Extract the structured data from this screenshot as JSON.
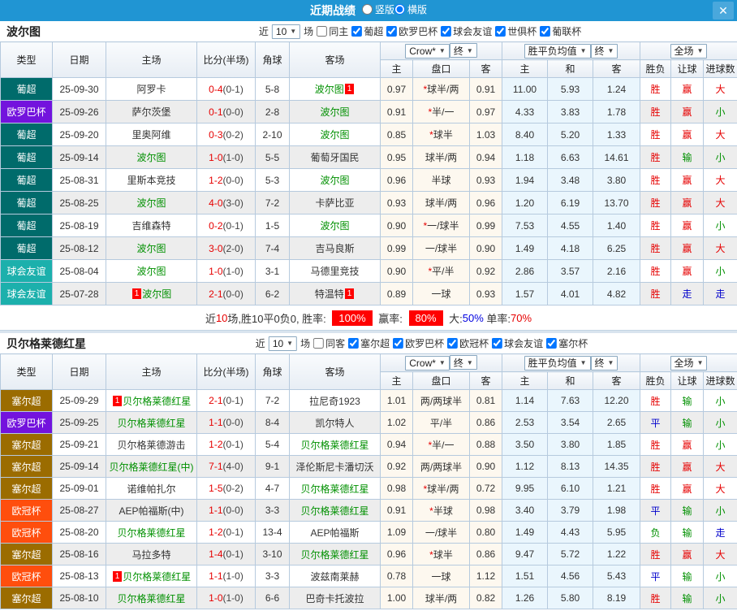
{
  "titlebar": {
    "title": "近期战绩",
    "radios": [
      {
        "label": "竖版",
        "selected": false
      },
      {
        "label": "横版",
        "selected": true
      }
    ],
    "close_label": "X"
  },
  "table_header": {
    "cols": [
      "类型",
      "日期",
      "主场",
      "比分(半场)",
      "角球",
      "客场"
    ],
    "odds_group": {
      "select1": "Crow*",
      "select2": "终",
      "sub": [
        "主",
        "盘口",
        "客"
      ]
    },
    "avg_group": {
      "select1": "胜平负均值",
      "select2": "终",
      "sub": [
        "主",
        "和",
        "客"
      ]
    },
    "result_group": {
      "select": "全场",
      "sub": [
        "胜负",
        "让球",
        "进球数"
      ]
    }
  },
  "sections": [
    {
      "team": "波尔图",
      "filter": {
        "near_label": "近",
        "count": "10",
        "games_label": "场",
        "same_label": "同主",
        "same_checked": false,
        "leagues": [
          {
            "label": "葡超",
            "checked": true
          },
          {
            "label": "欧罗巴杯",
            "checked": true
          },
          {
            "label": "球会友谊",
            "checked": true
          },
          {
            "label": "世俱杯",
            "checked": true
          },
          {
            "label": "葡联杯",
            "checked": true
          }
        ]
      },
      "rows": [
        {
          "type": "葡超",
          "tc": "#006b6b",
          "date": "25-09-30",
          "home": "阿罗卡",
          "homeGreen": false,
          "homeBadge": "",
          "ft": "0-4",
          "ht": "(0-1)",
          "corner": "5-8",
          "away": "波尔图",
          "awayGreen": true,
          "awayBadge": "1",
          "o1": "0.97",
          "star": true,
          "hcap": "球半/两",
          "o2": "0.91",
          "a1": "11.00",
          "a2": "5.93",
          "a3": "1.24",
          "res": [
            [
              "胜",
              "r"
            ],
            [
              "赢",
              "r"
            ],
            [
              "大",
              "r"
            ]
          ]
        },
        {
          "type": "欧罗巴杯",
          "tc": "#7313dd",
          "date": "25-09-26",
          "home": "萨尔茨堡",
          "homeGreen": false,
          "homeBadge": "",
          "ft": "0-1",
          "ht": "(0-0)",
          "corner": "2-8",
          "away": "波尔图",
          "awayGreen": true,
          "awayBadge": "",
          "o1": "0.91",
          "star": true,
          "hcap": "半/一",
          "o2": "0.97",
          "a1": "4.33",
          "a2": "3.83",
          "a3": "1.78",
          "res": [
            [
              "胜",
              "r"
            ],
            [
              "赢",
              "r"
            ],
            [
              "小",
              "g"
            ]
          ]
        },
        {
          "type": "葡超",
          "tc": "#006b6b",
          "date": "25-09-20",
          "home": "里奥阿维",
          "homeGreen": false,
          "homeBadge": "",
          "ft": "0-3",
          "ht": "(0-2)",
          "corner": "2-10",
          "away": "波尔图",
          "awayGreen": true,
          "awayBadge": "",
          "o1": "0.85",
          "star": true,
          "hcap": "球半",
          "o2": "1.03",
          "a1": "8.40",
          "a2": "5.20",
          "a3": "1.33",
          "res": [
            [
              "胜",
              "r"
            ],
            [
              "赢",
              "r"
            ],
            [
              "大",
              "r"
            ]
          ]
        },
        {
          "type": "葡超",
          "tc": "#006b6b",
          "date": "25-09-14",
          "home": "波尔图",
          "homeGreen": true,
          "homeBadge": "",
          "ft": "1-0",
          "ht": "(1-0)",
          "corner": "5-5",
          "away": "葡萄牙国民",
          "awayGreen": false,
          "awayBadge": "",
          "o1": "0.95",
          "star": false,
          "hcap": "球半/两",
          "o2": "0.94",
          "a1": "1.18",
          "a2": "6.63",
          "a3": "14.61",
          "res": [
            [
              "胜",
              "r"
            ],
            [
              "输",
              "g"
            ],
            [
              "小",
              "g"
            ]
          ]
        },
        {
          "type": "葡超",
          "tc": "#006b6b",
          "date": "25-08-31",
          "home": "里斯本竞技",
          "homeGreen": false,
          "homeBadge": "",
          "ft": "1-2",
          "ht": "(0-0)",
          "corner": "5-3",
          "away": "波尔图",
          "awayGreen": true,
          "awayBadge": "",
          "o1": "0.96",
          "star": false,
          "hcap": "半球",
          "o2": "0.93",
          "a1": "1.94",
          "a2": "3.48",
          "a3": "3.80",
          "res": [
            [
              "胜",
              "r"
            ],
            [
              "赢",
              "r"
            ],
            [
              "大",
              "r"
            ]
          ]
        },
        {
          "type": "葡超",
          "tc": "#006b6b",
          "date": "25-08-25",
          "home": "波尔图",
          "homeGreen": true,
          "homeBadge": "",
          "ft": "4-0",
          "ht": "(3-0)",
          "corner": "7-2",
          "away": "卡萨比亚",
          "awayGreen": false,
          "awayBadge": "",
          "o1": "0.93",
          "star": false,
          "hcap": "球半/两",
          "o2": "0.96",
          "a1": "1.20",
          "a2": "6.19",
          "a3": "13.70",
          "res": [
            [
              "胜",
              "r"
            ],
            [
              "赢",
              "r"
            ],
            [
              "大",
              "r"
            ]
          ]
        },
        {
          "type": "葡超",
          "tc": "#006b6b",
          "date": "25-08-19",
          "home": "吉维森特",
          "homeGreen": false,
          "homeBadge": "",
          "ft": "0-2",
          "ht": "(0-1)",
          "corner": "1-5",
          "away": "波尔图",
          "awayGreen": true,
          "awayBadge": "",
          "o1": "0.90",
          "star": true,
          "hcap": "一/球半",
          "o2": "0.99",
          "a1": "7.53",
          "a2": "4.55",
          "a3": "1.40",
          "res": [
            [
              "胜",
              "r"
            ],
            [
              "赢",
              "r"
            ],
            [
              "小",
              "g"
            ]
          ]
        },
        {
          "type": "葡超",
          "tc": "#006b6b",
          "date": "25-08-12",
          "home": "波尔图",
          "homeGreen": true,
          "homeBadge": "",
          "ft": "3-0",
          "ht": "(2-0)",
          "corner": "7-4",
          "away": "吉马良斯",
          "awayGreen": false,
          "awayBadge": "",
          "o1": "0.99",
          "star": false,
          "hcap": "一/球半",
          "o2": "0.90",
          "a1": "1.49",
          "a2": "4.18",
          "a3": "6.25",
          "res": [
            [
              "胜",
              "r"
            ],
            [
              "赢",
              "r"
            ],
            [
              "大",
              "r"
            ]
          ]
        },
        {
          "type": "球会友谊",
          "tc": "#1cb0ac",
          "date": "25-08-04",
          "home": "波尔图",
          "homeGreen": true,
          "homeBadge": "",
          "ft": "1-0",
          "ht": "(1-0)",
          "corner": "3-1",
          "away": "马德里竞技",
          "awayGreen": false,
          "awayBadge": "",
          "o1": "0.90",
          "star": true,
          "hcap": "平/半",
          "o2": "0.92",
          "a1": "2.86",
          "a2": "3.57",
          "a3": "2.16",
          "res": [
            [
              "胜",
              "r"
            ],
            [
              "赢",
              "r"
            ],
            [
              "小",
              "g"
            ]
          ]
        },
        {
          "type": "球会友谊",
          "tc": "#1cb0ac",
          "date": "25-07-28",
          "home": "波尔图",
          "homeGreen": true,
          "homeBadge": "1",
          "ft": "2-1",
          "ht": "(0-0)",
          "corner": "6-2",
          "away": "特温特",
          "awayGreen": false,
          "awayBadge": "1",
          "o1": "0.89",
          "star": false,
          "hcap": "一球",
          "o2": "0.93",
          "a1": "1.57",
          "a2": "4.01",
          "a3": "4.82",
          "res": [
            [
              "胜",
              "r"
            ],
            [
              "走",
              "b"
            ],
            [
              "走",
              "b"
            ]
          ]
        }
      ],
      "summary": [
        [
          "近",
          "k"
        ],
        [
          "10",
          "r"
        ],
        [
          "场,胜10平0负0, 胜率: ",
          "k"
        ],
        [
          "100%",
          "hl"
        ],
        [
          " 赢率: ",
          "k"
        ],
        [
          "80%",
          "hl"
        ],
        [
          " 大:",
          "k"
        ],
        [
          "50%",
          "b"
        ],
        [
          " 单率:",
          "k"
        ],
        [
          "70%",
          "r"
        ]
      ]
    },
    {
      "team": "贝尔格莱德红星",
      "filter": {
        "near_label": "近",
        "count": "10",
        "games_label": "场",
        "same_label": "同客",
        "same_checked": false,
        "leagues": [
          {
            "label": "塞尔超",
            "checked": true
          },
          {
            "label": "欧罗巴杯",
            "checked": true
          },
          {
            "label": "欧冠杯",
            "checked": true
          },
          {
            "label": "球会友谊",
            "checked": true
          },
          {
            "label": "塞尔杯",
            "checked": true
          }
        ]
      },
      "rows": [
        {
          "type": "塞尔超",
          "tc": "#9b6c00",
          "date": "25-09-29",
          "home": "贝尔格莱德红星",
          "homeGreen": true,
          "homeBadge": "1",
          "ft": "2-1",
          "ht": "(0-1)",
          "corner": "7-2",
          "away": "拉尼奇1923",
          "awayGreen": false,
          "awayBadge": "",
          "o1": "1.01",
          "star": false,
          "hcap": "两/两球半",
          "o2": "0.81",
          "a1": "1.14",
          "a2": "7.63",
          "a3": "12.20",
          "res": [
            [
              "胜",
              "r"
            ],
            [
              "输",
              "g"
            ],
            [
              "小",
              "g"
            ]
          ]
        },
        {
          "type": "欧罗巴杯",
          "tc": "#7313dd",
          "date": "25-09-25",
          "home": "贝尔格莱德红星",
          "homeGreen": true,
          "homeBadge": "",
          "ft": "1-1",
          "ht": "(0-0)",
          "corner": "8-4",
          "away": "凯尔特人",
          "awayGreen": false,
          "awayBadge": "",
          "o1": "1.02",
          "star": false,
          "hcap": "平/半",
          "o2": "0.86",
          "a1": "2.53",
          "a2": "3.54",
          "a3": "2.65",
          "res": [
            [
              "平",
              "b"
            ],
            [
              "输",
              "g"
            ],
            [
              "小",
              "g"
            ]
          ]
        },
        {
          "type": "塞尔超",
          "tc": "#9b6c00",
          "date": "25-09-21",
          "home": "贝尔格莱德游击",
          "homeGreen": false,
          "homeBadge": "",
          "ft": "1-2",
          "ht": "(0-1)",
          "corner": "5-4",
          "away": "贝尔格莱德红星",
          "awayGreen": true,
          "awayBadge": "",
          "o1": "0.94",
          "star": true,
          "hcap": "半/一",
          "o2": "0.88",
          "a1": "3.50",
          "a2": "3.80",
          "a3": "1.85",
          "res": [
            [
              "胜",
              "r"
            ],
            [
              "赢",
              "r"
            ],
            [
              "小",
              "g"
            ]
          ]
        },
        {
          "type": "塞尔超",
          "tc": "#9b6c00",
          "date": "25-09-14",
          "home": "贝尔格莱德红星(中)",
          "homeGreen": true,
          "homeBadge": "",
          "ft": "7-1",
          "ht": "(4-0)",
          "corner": "9-1",
          "away": "泽伦斯尼卡潘切沃",
          "awayGreen": false,
          "awayBadge": "",
          "o1": "0.92",
          "star": false,
          "hcap": "两/两球半",
          "o2": "0.90",
          "a1": "1.12",
          "a2": "8.13",
          "a3": "14.35",
          "res": [
            [
              "胜",
              "r"
            ],
            [
              "赢",
              "r"
            ],
            [
              "大",
              "r"
            ]
          ]
        },
        {
          "type": "塞尔超",
          "tc": "#9b6c00",
          "date": "25-09-01",
          "home": "诺维帕扎尔",
          "homeGreen": false,
          "homeBadge": "",
          "ft": "1-5",
          "ht": "(0-2)",
          "corner": "4-7",
          "away": "贝尔格莱德红星",
          "awayGreen": true,
          "awayBadge": "",
          "o1": "0.98",
          "star": true,
          "hcap": "球半/两",
          "o2": "0.72",
          "a1": "9.95",
          "a2": "6.10",
          "a3": "1.21",
          "res": [
            [
              "胜",
              "r"
            ],
            [
              "赢",
              "r"
            ],
            [
              "大",
              "r"
            ]
          ]
        },
        {
          "type": "欧冠杯",
          "tc": "#ff4e0d",
          "date": "25-08-27",
          "home": "AEP帕福斯(中)",
          "homeGreen": false,
          "homeBadge": "",
          "ft": "1-1",
          "ht": "(0-0)",
          "corner": "3-3",
          "away": "贝尔格莱德红星",
          "awayGreen": true,
          "awayBadge": "",
          "o1": "0.91",
          "star": true,
          "hcap": "半球",
          "o2": "0.98",
          "a1": "3.40",
          "a2": "3.79",
          "a3": "1.98",
          "res": [
            [
              "平",
              "b"
            ],
            [
              "输",
              "g"
            ],
            [
              "小",
              "g"
            ]
          ]
        },
        {
          "type": "欧冠杯",
          "tc": "#ff4e0d",
          "date": "25-08-20",
          "home": "贝尔格莱德红星",
          "homeGreen": true,
          "homeBadge": "",
          "ft": "1-2",
          "ht": "(0-1)",
          "corner": "13-4",
          "away": "AEP帕福斯",
          "awayGreen": false,
          "awayBadge": "",
          "o1": "1.09",
          "star": false,
          "hcap": "一/球半",
          "o2": "0.80",
          "a1": "1.49",
          "a2": "4.43",
          "a3": "5.95",
          "res": [
            [
              "负",
              "g"
            ],
            [
              "输",
              "g"
            ],
            [
              "走",
              "b"
            ]
          ]
        },
        {
          "type": "塞尔超",
          "tc": "#9b6c00",
          "date": "25-08-16",
          "home": "马拉多特",
          "homeGreen": false,
          "homeBadge": "",
          "ft": "1-4",
          "ht": "(0-1)",
          "corner": "3-10",
          "away": "贝尔格莱德红星",
          "awayGreen": true,
          "awayBadge": "",
          "o1": "0.96",
          "star": true,
          "hcap": "球半",
          "o2": "0.86",
          "a1": "9.47",
          "a2": "5.72",
          "a3": "1.22",
          "res": [
            [
              "胜",
              "r"
            ],
            [
              "赢",
              "r"
            ],
            [
              "大",
              "r"
            ]
          ]
        },
        {
          "type": "欧冠杯",
          "tc": "#ff4e0d",
          "date": "25-08-13",
          "home": "贝尔格莱德红星",
          "homeGreen": true,
          "homeBadge": "1",
          "ft": "1-1",
          "ht": "(1-0)",
          "corner": "3-3",
          "away": "波兹南莱赫",
          "awayGreen": false,
          "awayBadge": "",
          "o1": "0.78",
          "star": false,
          "hcap": "一球",
          "o2": "1.12",
          "a1": "1.51",
          "a2": "4.56",
          "a3": "5.43",
          "res": [
            [
              "平",
              "b"
            ],
            [
              "输",
              "g"
            ],
            [
              "小",
              "g"
            ]
          ]
        },
        {
          "type": "塞尔超",
          "tc": "#9b6c00",
          "date": "25-08-10",
          "home": "贝尔格莱德红星",
          "homeGreen": true,
          "homeBadge": "",
          "ft": "1-0",
          "ht": "(1-0)",
          "corner": "6-6",
          "away": "巴奇卡托波拉",
          "awayGreen": false,
          "awayBadge": "",
          "o1": "1.00",
          "star": false,
          "hcap": "球半/两",
          "o2": "0.82",
          "a1": "1.26",
          "a2": "5.80",
          "a3": "8.19",
          "res": [
            [
              "胜",
              "r"
            ],
            [
              "输",
              "g"
            ],
            [
              "小",
              "g"
            ]
          ]
        }
      ],
      "summary": null
    }
  ]
}
